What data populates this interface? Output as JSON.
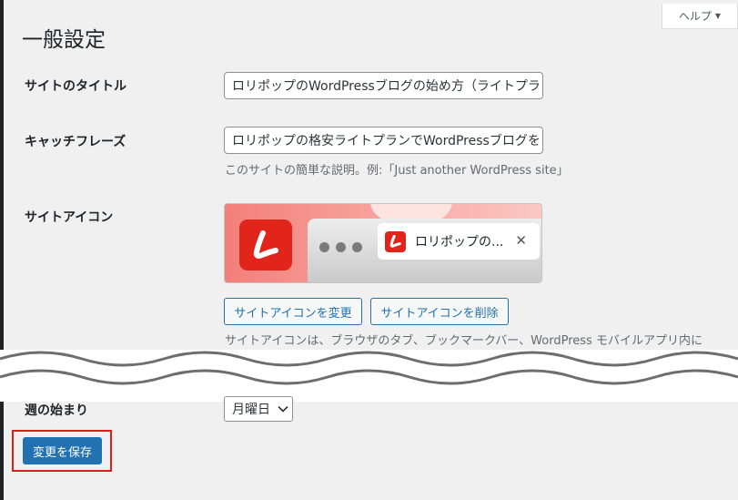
{
  "help": {
    "label": "ヘルプ"
  },
  "page_title": "一般設定",
  "fields": {
    "site_title": {
      "label": "サイトのタイトル",
      "value": "ロリポップのWordPressブログの始め方（ライトプラ"
    },
    "tagline": {
      "label": "キャッチフレーズ",
      "value": "ロリポップの格安ライトプランでWordPressブログを",
      "description": "このサイトの簡単な説明。例:「Just another WordPress site」"
    },
    "site_icon": {
      "label": "サイトアイコン",
      "preview_tab_title": "ロリポップの...",
      "change_button": "サイトアイコンを変更",
      "remove_button": "サイトアイコンを削除",
      "description": "サイトアイコンは、ブラウザのタブ、ブックマークバー、WordPress モバイルアプリ内に"
    },
    "week_start": {
      "label": "週の始まり",
      "selected": "月曜日"
    }
  },
  "save_button": "変更を保存",
  "colors": {
    "primary": "#2271b1",
    "highlight": "#d9201b",
    "lolipop_red": "#e1251b",
    "background": "#f0f0f1"
  },
  "icons": [
    "chevron-down-icon",
    "close-icon",
    "lolipop-logo-icon"
  ]
}
